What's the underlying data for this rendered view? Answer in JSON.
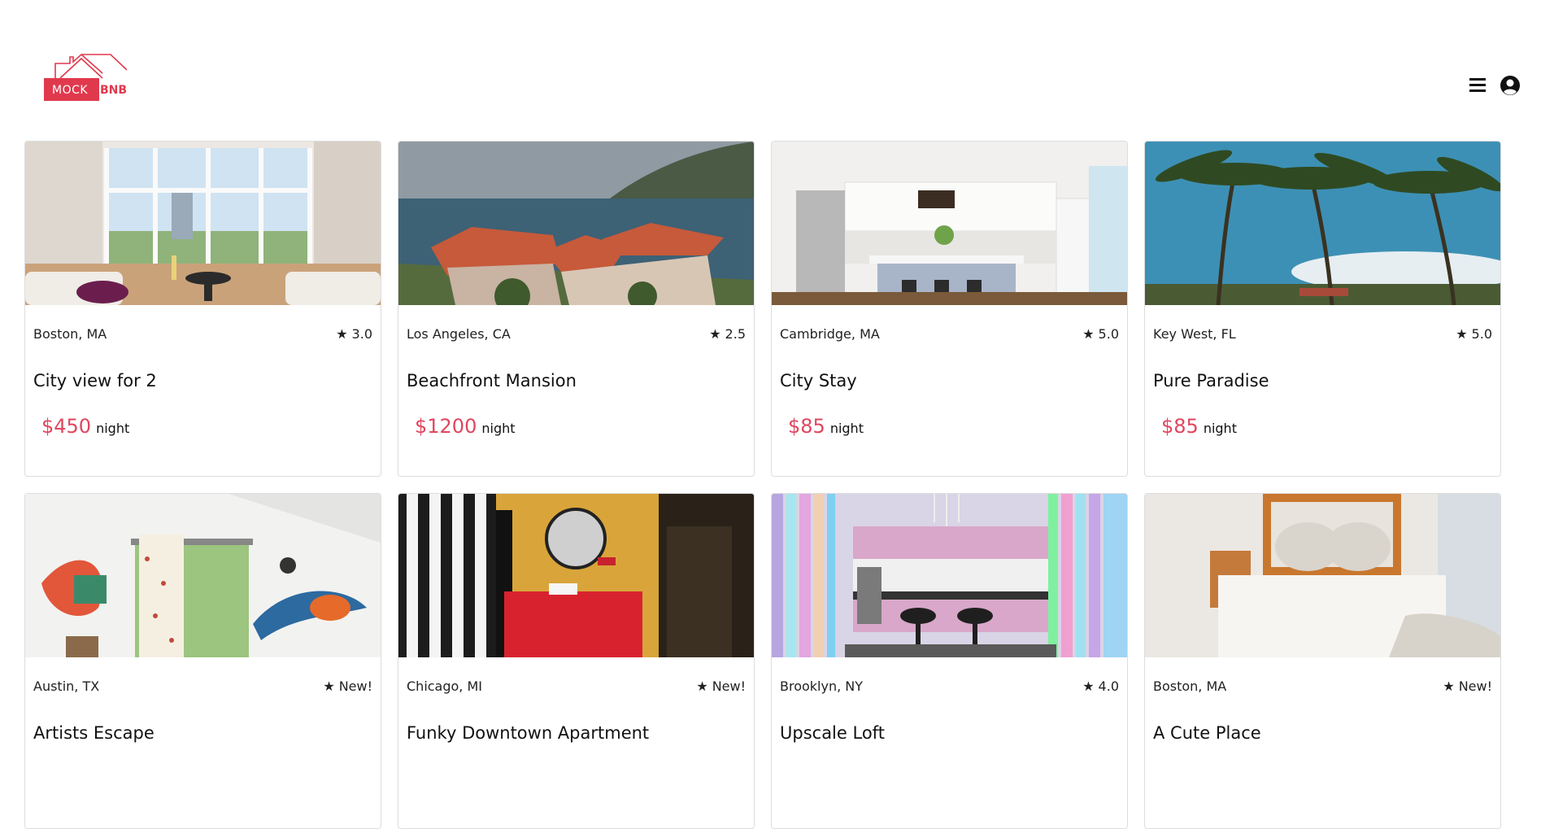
{
  "brand": {
    "name_left": "MOCK",
    "name_right": "BNB",
    "color": "#e0394d"
  },
  "header": {
    "menu_icon": "hamburger-menu-icon",
    "user_icon": "user-circle-icon"
  },
  "price_color": "#e0465e",
  "listings": [
    {
      "location": "Boston, MA",
      "rating": "3.0",
      "title": "City view for 2",
      "price": "$450",
      "unit": "night",
      "image": "living-room-city-view"
    },
    {
      "location": "Los Angeles, CA",
      "rating": "2.5",
      "title": "Beachfront Mansion",
      "price": "$1200",
      "unit": "night",
      "image": "villa-by-the-sea"
    },
    {
      "location": "Cambridge, MA",
      "rating": "5.0",
      "title": "City Stay",
      "price": "$85",
      "unit": "night",
      "image": "white-kitchen"
    },
    {
      "location": "Key West, FL",
      "rating": "5.0",
      "title": "Pure Paradise",
      "price": "$85",
      "unit": "night",
      "image": "palm-trees"
    },
    {
      "location": "Austin, TX",
      "rating": "New!",
      "title": "Artists Escape",
      "price": "",
      "unit": "",
      "image": "colorful-attic-room"
    },
    {
      "location": "Chicago, MI",
      "rating": "New!",
      "title": "Funky Downtown Apartment",
      "price": "",
      "unit": "",
      "image": "red-yellow-bathroom"
    },
    {
      "location": "Brooklyn, NY",
      "rating": "4.0",
      "title": "Upscale Loft",
      "price": "",
      "unit": "",
      "image": "neon-kitchen"
    },
    {
      "location": "Boston, MA",
      "rating": "New!",
      "title": "A Cute Place",
      "price": "",
      "unit": "",
      "image": "bedroom"
    }
  ]
}
